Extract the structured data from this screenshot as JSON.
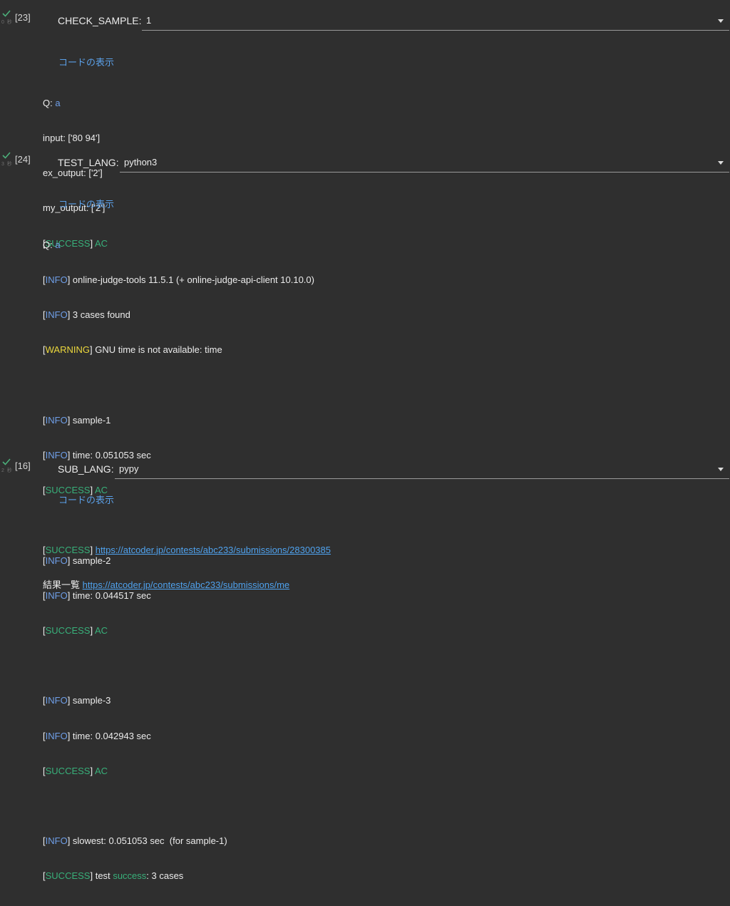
{
  "cells": [
    {
      "prompt": "[23]",
      "widget_label": "CHECK_SAMPLE:",
      "select_value": "1",
      "show_code": "コードの表示",
      "output": {
        "q_label": "Q: ",
        "q_value": "a",
        "lines": [
          "input: ['80 94']",
          "ex_output: ['2']",
          "my_output: ['2']"
        ],
        "status_tag": "SUCCESS",
        "status_text": "AC"
      }
    },
    {
      "prompt": "[24]",
      "widget_label": "TEST_LANG:",
      "select_value": "python3",
      "show_code": "コードの表示",
      "output": {
        "q_label": "Q: ",
        "q_value": "a",
        "info_tag": "INFO",
        "warning_tag": "WARNING",
        "success_tag": "SUCCESS",
        "header": [
          "online-judge-tools 11.5.1 (+ online-judge-api-client 10.10.0)",
          "3 cases found"
        ],
        "warning_text": "GNU time is not available: time",
        "samples": [
          {
            "name": "sample-1",
            "time": "time: 0.051053 sec",
            "result": "AC"
          },
          {
            "name": "sample-2",
            "time": "time: 0.044517 sec",
            "result": "AC"
          },
          {
            "name": "sample-3",
            "time": "time: 0.042943 sec",
            "result": "AC"
          }
        ],
        "slowest": "slowest: 0.051053 sec  (for sample-1)",
        "test_word": "test",
        "success_word": "success",
        "test_count": ": 3 cases"
      }
    },
    {
      "prompt": "[16]",
      "widget_label": "SUB_LANG:",
      "select_value": "pypy",
      "show_code": "コードの表示",
      "output": {
        "success_tag": "SUCCESS",
        "submission_url": "https://atcoder.jp/contests/abc233/submissions/28300385",
        "results_label": "結果一覧",
        "results_url": "https://atcoder.jp/contests/abc233/submissions/me"
      }
    }
  ],
  "colors": {
    "background": "#2f2f2f",
    "info": "#6f9fe8",
    "success": "#38b07a",
    "warning": "#ecd83d",
    "link": "#4fa2ee"
  }
}
